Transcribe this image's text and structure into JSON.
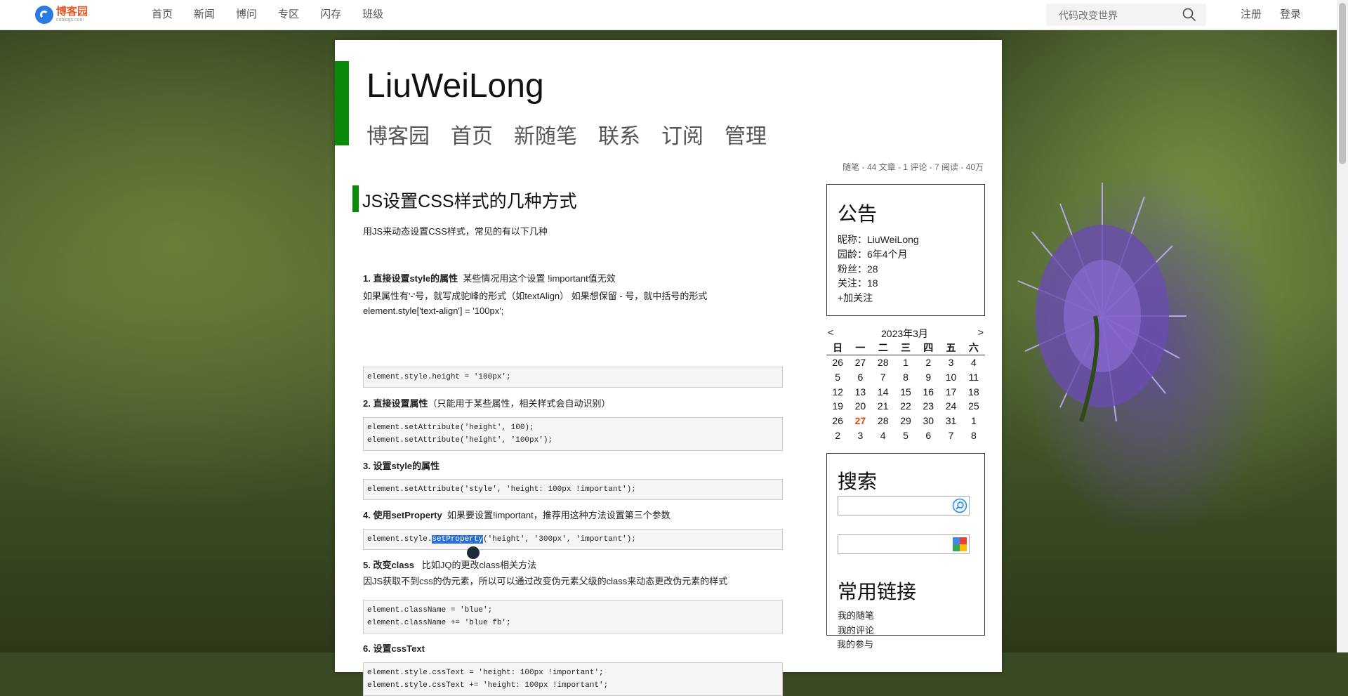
{
  "topbar": {
    "logo_text": "博客园",
    "logo_sub": "cnblogs.com",
    "nav": [
      "首页",
      "新闻",
      "博问",
      "专区",
      "闪存",
      "班级"
    ],
    "search_placeholder": "代码改变世界",
    "register": "注册",
    "login": "登录"
  },
  "blog": {
    "title": "LiuWeiLong",
    "nav": [
      "博客园",
      "首页",
      "新随笔",
      "联系",
      "订阅",
      "管理"
    ],
    "stats": "随笔 - 44  文章 - 1  评论 - 7  阅读 - 40万"
  },
  "post": {
    "title": "JS设置CSS样式的几种方式",
    "intro": "用JS来动态设置CSS样式，常见的有以下几种",
    "s1_title": "1. 直接设置style的属性",
    "s1_note": "某些情况用这个设置 !important值无效",
    "s1_p1": "如果属性有'-'号，就写成驼峰的形式（如textAlign）  如果想保留 - 号，就中括号的形式",
    "s1_p2": "element.style['text-align'] = '100px';",
    "s1_code": "element.style.height = '100px';",
    "s2_title": "2. 直接设置属性",
    "s2_note": "（只能用于某些属性，相关样式会自动识别）",
    "s2_code": "element.setAttribute('height', 100);\nelement.setAttribute('height', '100px');",
    "s3_title": "3. 设置style的属性",
    "s3_code": "element.setAttribute('style', 'height: 100px !important');",
    "s4_title": "4. 使用setProperty",
    "s4_note": "如果要设置!important，推荐用这种方法设置第三个参数",
    "s4_code_pre": "element.style.",
    "s4_code_sel": "setProperty",
    "s4_code_post": "('height', '300px', 'important');",
    "s5_title": "5. 改变class",
    "s5_note": "比如JQ的更改class相关方法",
    "s5_p1": "因JS获取不到css的伪元素，所以可以通过改变伪元素父级的class来动态更改伪元素的样式",
    "s5_code": "element.className = 'blue';\nelement.className += 'blue fb';",
    "s6_title": "6. 设置cssText",
    "s6_code": "element.style.cssText = 'height: 100px !important';\nelement.style.cssText += 'height: 100px !important';"
  },
  "sidebar": {
    "notice_title": "公告",
    "nickname_label": "昵称：",
    "nickname": "LiuWeiLong",
    "age_label": "园龄：",
    "age": "6年4个月",
    "fans_label": "粉丝：",
    "fans": "28",
    "follow_label": "关注：",
    "follow": "18",
    "add_follow": "+加关注",
    "calendar": {
      "prev": "<",
      "month": "2023年3月",
      "next": ">",
      "weekdays": [
        "日",
        "一",
        "二",
        "三",
        "四",
        "五",
        "六"
      ],
      "weeks": [
        [
          "26",
          "27",
          "28",
          "1",
          "2",
          "3",
          "4"
        ],
        [
          "5",
          "6",
          "7",
          "8",
          "9",
          "10",
          "11"
        ],
        [
          "12",
          "13",
          "14",
          "15",
          "16",
          "17",
          "18"
        ],
        [
          "19",
          "20",
          "21",
          "22",
          "23",
          "24",
          "25"
        ],
        [
          "26",
          "27",
          "28",
          "29",
          "30",
          "31",
          "1"
        ],
        [
          "2",
          "3",
          "4",
          "5",
          "6",
          "7",
          "8"
        ]
      ],
      "today": "27"
    },
    "search_title": "搜索",
    "links_title": "常用链接",
    "links": [
      "我的随笔",
      "我的评论",
      "我的参与"
    ]
  }
}
